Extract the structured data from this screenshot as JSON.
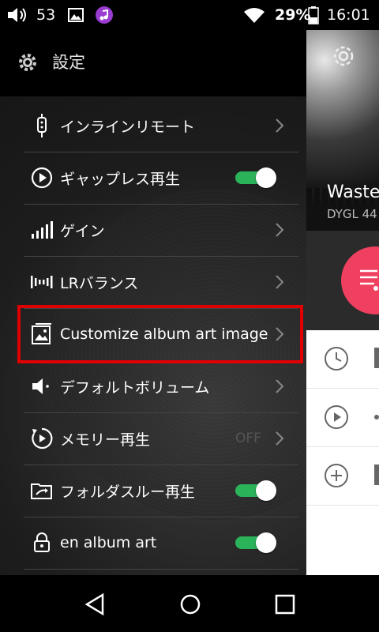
{
  "status_bar": {
    "volume_level": "53",
    "battery_percent": "29%",
    "time": "16:01",
    "icons": [
      "volume-icon",
      "image-icon",
      "music-app-icon",
      "wifi-icon",
      "battery-icon"
    ]
  },
  "drawer": {
    "header_title": "設定",
    "items": [
      {
        "label": "インラインリモート",
        "icon": "remote-icon",
        "control": "chevron"
      },
      {
        "label": "ギャップレス再生",
        "icon": "gapless-play-icon",
        "control": "toggle",
        "on": true
      },
      {
        "label": "ゲイン",
        "icon": "gain-bars-icon",
        "control": "chevron"
      },
      {
        "label": "LRバランス",
        "icon": "balance-icon",
        "control": "chevron"
      },
      {
        "label": "Customize album art image",
        "icon": "album-image-icon",
        "control": "chevron",
        "highlighted": true
      },
      {
        "label": "デフォルトボリューム",
        "icon": "speaker-icon",
        "control": "chevron"
      },
      {
        "label": "メモリー再生",
        "icon": "memory-play-icon",
        "control": "chevron",
        "value": "OFF"
      },
      {
        "label": "フォルダスルー再生",
        "icon": "folder-through-icon",
        "control": "toggle",
        "on": true
      },
      {
        "label": "en album art",
        "icon": "lock-icon",
        "control": "toggle",
        "on": true
      }
    ]
  },
  "background": {
    "album_title": "Waste",
    "album_artist": "DYGL 44"
  },
  "colors": {
    "accent_pink": "#f0405f",
    "toggle_green": "#2bb35a",
    "highlight_red": "#e00000"
  }
}
